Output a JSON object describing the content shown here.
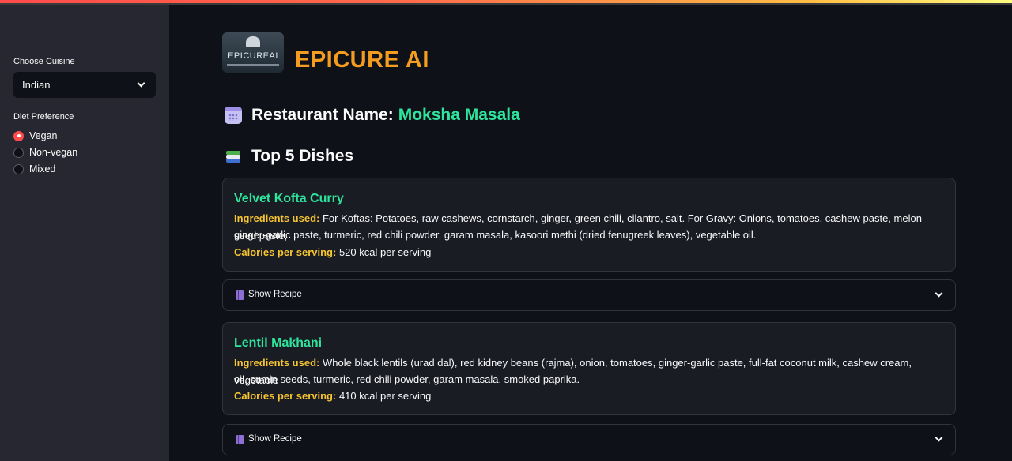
{
  "sidebar": {
    "cuisine_label": "Choose Cuisine",
    "cuisine_value": "Indian",
    "diet_label": "Diet Preference",
    "diet_options": [
      {
        "label": "Vegan",
        "selected": true
      },
      {
        "label": "Non-vegan",
        "selected": false
      },
      {
        "label": "Mixed",
        "selected": false
      }
    ]
  },
  "header": {
    "logo_text": "EPICUREAI",
    "title": "EPICURE AI"
  },
  "restaurant": {
    "label": "Restaurant Name:",
    "name": "Moksha Masala"
  },
  "dishes_heading": "Top 5 Dishes",
  "dishes": [
    {
      "name": "Velvet Kofta Curry",
      "ingredients_key": "Ingredients used:",
      "ingredients_line1": "For Koftas: Potatoes, raw cashews, cornstarch, ginger, green chili, cilantro, salt. For Gravy: Onions, tomatoes, cashew paste, melon seed paste,",
      "ingredients_line2": "ginger-garlic paste, turmeric, red chili powder, garam masala, kasoori methi (dried fenugreek leaves), vegetable oil.",
      "calories_key": "Calories per serving:",
      "calories": "520 kcal per serving",
      "recipe_label": "Show Recipe"
    },
    {
      "name": "Lentil Makhani",
      "ingredients_key": "Ingredients used:",
      "ingredients_line1": "Whole black lentils (urad dal), red kidney beans (rajma), onion, tomatoes, ginger-garlic paste, full-fat coconut milk, cashew cream, vegetable",
      "ingredients_line2": "oil, cumin seeds, turmeric, red chili powder, garam masala, smoked paprika.",
      "calories_key": "Calories per serving:",
      "calories": "410 kcal per serving",
      "recipe_label": "Show Recipe"
    }
  ],
  "colors": {
    "accent_green": "#2ee59d",
    "title_orange": "#f39c1f",
    "key_yellow": "#f7c531",
    "radio_red": "#ff4b4b"
  },
  "icons": {
    "restaurant": "calendar-icon",
    "dishes": "books-icon",
    "recipe": "notebook-icon"
  }
}
